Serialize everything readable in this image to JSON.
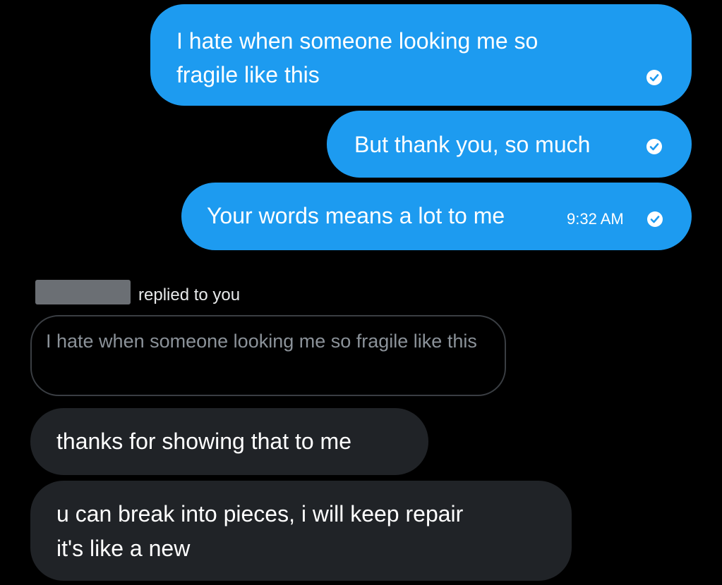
{
  "sent_messages": [
    {
      "text_line1": "I hate when someone looking me so",
      "text_line2": "fragile like this"
    },
    {
      "text": "But thank you, so much"
    },
    {
      "text": "Your words means a lot to me",
      "time": "9:32 AM"
    }
  ],
  "reply": {
    "label": "replied to you",
    "quoted_text": "I hate when someone looking me so fragile like this"
  },
  "received_messages": [
    {
      "text": "thanks for showing that to me"
    },
    {
      "text_line1": "u can break into pieces, i will keep repair",
      "text_line2": "it's like a new"
    }
  ],
  "colors": {
    "sent_bubble": "#1d9bf0",
    "received_bubble": "#202327",
    "background": "#000000"
  },
  "icons": {
    "read_receipt": "check-circle-icon"
  }
}
